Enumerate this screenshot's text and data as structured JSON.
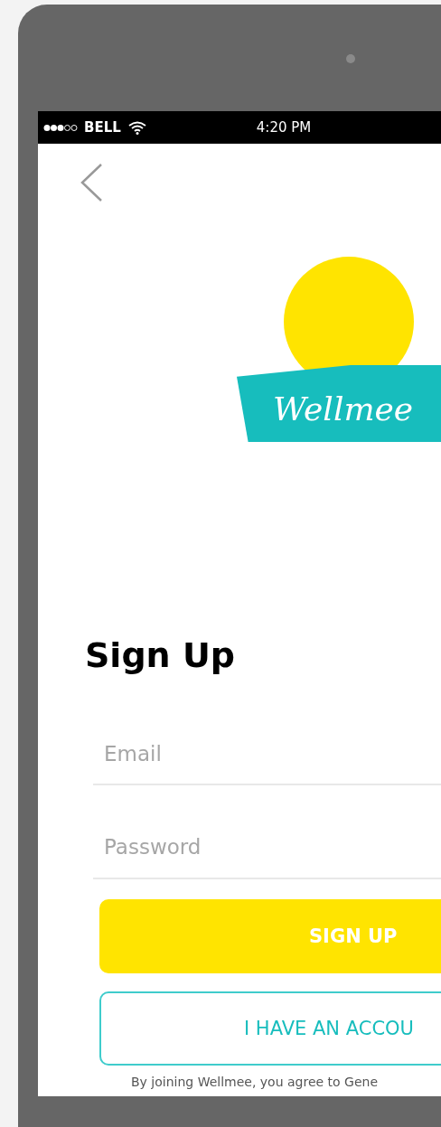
{
  "status_bar": {
    "carrier": "BELL",
    "time": "4:20 PM"
  },
  "logo": {
    "text": "Wellmee"
  },
  "title": "Sign Up",
  "fields": [
    {
      "placeholder": "Email"
    },
    {
      "placeholder": "Password"
    }
  ],
  "buttons": [
    {
      "kind": "primary",
      "label": "SIGN UP"
    },
    {
      "kind": "outline",
      "label": "I HAVE AN ACCOU"
    }
  ],
  "footer": "By joining Wellmee, you agree to Gene"
}
